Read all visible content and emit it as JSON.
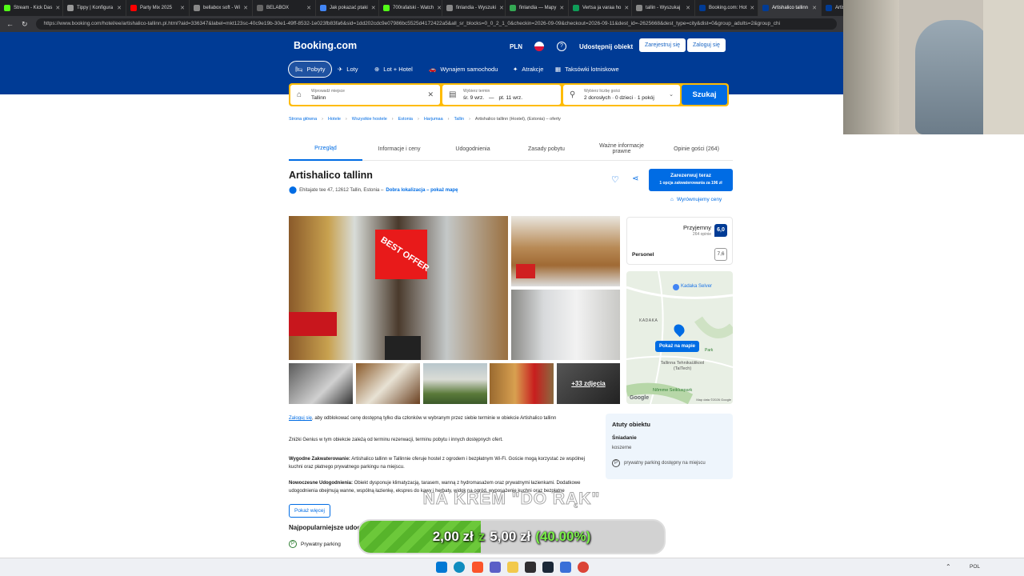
{
  "browser": {
    "tabs": [
      {
        "label": "Stream - Kick Das",
        "color": "#53fc18"
      },
      {
        "label": "Tippy | Konfigura",
        "color": "#999999"
      },
      {
        "label": "Party Mix 2025",
        "color": "#ff0000"
      },
      {
        "label": "bellabox soft - Wi",
        "color": "#888888"
      },
      {
        "label": "BELABOX",
        "color": "#666666"
      },
      {
        "label": "Jak pokazać ptaki",
        "color": "#4285f4"
      },
      {
        "label": "700rafalski - Watch",
        "color": "#53fc18"
      },
      {
        "label": "finlandia - Wyszuki",
        "color": "#888888"
      },
      {
        "label": "finlandia — Mapy",
        "color": "#34a853"
      },
      {
        "label": "Vertsa ja varaa ho",
        "color": "#0f9d58"
      },
      {
        "label": "tallin - Wyszukaj",
        "color": "#888888"
      },
      {
        "label": "Booking.com: Hot",
        "color": "#003b95"
      },
      {
        "label": "Artishalico tallinn",
        "color": "#003b95"
      },
      {
        "label": "Artishal",
        "color": "#003b95"
      }
    ],
    "url": "https://www.booking.com/hotel/ee/artishalico-tallinn.pl.html?aid=336347&label=mkt123sc-40c9e19b-30e1-49ff-8532-1e023fb83fa6&sid=1dd202cdc9e07986bc5525d4172422a5&all_sr_blocks=0_0_2_1_0&checkin=2026-09-09&checkout=2026-09-11&dest_id=-2625668&dest_type=city&dist=0&group_adults=2&group_chi"
  },
  "header": {
    "logo": "Booking.com",
    "currency": "PLN",
    "help": "?",
    "list_property": "Udostępnij obiekt",
    "register": "Zarejestruj się",
    "login": "Zaloguj się",
    "nav": [
      {
        "label": "Pobyty",
        "icon": "bed-icon"
      },
      {
        "label": "Loty",
        "icon": "plane-icon"
      },
      {
        "label": "Lot + Hotel",
        "icon": "flight-hotel-icon"
      },
      {
        "label": "Wynajem samochodu",
        "icon": "car-icon"
      },
      {
        "label": "Atrakcje",
        "icon": "attractions-icon"
      },
      {
        "label": "Taksówki lotniskowe",
        "icon": "taxi-icon"
      }
    ]
  },
  "search": {
    "destination_label": "Wprowadź miejsce",
    "destination_value": "Tallinn",
    "dates_label": "Wybierz termin",
    "date_from": "śr. 9 wrz.",
    "date_sep": "—",
    "date_to": "pt. 11 wrz.",
    "guests_label": "Wybierz liczbę gości",
    "guests_value": "2 dorosłych · 0 dzieci · 1 pokój",
    "button": "Szukaj"
  },
  "breadcrumbs": [
    "Strona główna",
    "Hotele",
    "Wszystkie hostele",
    "Estonia",
    "Harjumaa",
    "Tallin",
    "Artishalico tallinn (Hostel), (Estonia) – oferty"
  ],
  "page_tabs": [
    "Przegląd",
    "Informacje i ceny",
    "Udogodnienia",
    "Zasady pobytu",
    "Ważne informacje prawne",
    "Opinie gości (264)"
  ],
  "hotel": {
    "name": "Artishalico tallinn",
    "address": "Ehitajate tee 47, 12612 Tallin, Estonia –",
    "location_link": "Dobra lokalizacja – pokaż mapę",
    "book_now": "Zarezerwuj teraz",
    "book_sub": "1 opcja zakwaterowania za 196 zł",
    "price_match": "Wyrównujemy ceny",
    "best_offer": "BEST OFFER",
    "more_photos": "+33 zdjęcia"
  },
  "reviews": {
    "label": "Przyjemny",
    "count": "264 opinie",
    "score": "6,0",
    "staff_label": "Personel",
    "staff_score": "7,6"
  },
  "map": {
    "show_map": "Pokaż na mapie",
    "places": [
      "Kadaka Selver",
      "KADAKA",
      "Tallinna Tehnikaülikool (TalTech)",
      "Nõmme Seikluspark",
      "Park"
    ],
    "attribution": "Map data ©2026 Google",
    "google": "Google"
  },
  "description": {
    "login_link": "Zaloguj się",
    "login_text": ", aby odblokować cenę dostępną tylko dla członków w wybranym przez siebie terminie w obiekcie Artishalico tallinn",
    "genius": "Zniżki Genius w tym obiekcie zależą od terminu rezerwacji, terminu pobytu i innych dostępnych ofert.",
    "comfort_title": "Wygodne Zakwaterowanie:",
    "comfort_text": " Artishalico tallinn w Tallinnie oferuje hostel z ogrodem i bezpłatnym Wi-Fi. Goście mogą korzystać ze wspólnej kuchni oraz płatnego prywatnego parkingu na miejscu.",
    "modern_title": "Nowoczesne Udogodnienia:",
    "modern_text": " Obiekt dysponuje klimatyzacją, tarasem, wanną z hydromasażem oraz prywatnymi łazienkami. Dodatkowe udogodnienia obejmują wanne, wspólną łazienkę, ekspres do kawy i herbaty, widok na ogród, wyposażenie kuchni oraz bezpłatne kosmetyki.",
    "show_more": "Pokaż więcej",
    "popular_title": "Najpopularniejsze udogodnienia",
    "popular_items": [
      "Prywatny parking"
    ]
  },
  "highlights": {
    "title": "Atuty obiektu",
    "breakfast_title": "Śniadanie",
    "breakfast_value": "koszerne",
    "parking": "prywatny parking dostępny na miejscu"
  },
  "overlay": {
    "message": "NA KREM \"DO RĄK\"",
    "current": "2,00 zł",
    "of": "z",
    "goal": "5,00 zł",
    "percent": "(40.00%)",
    "progress": 0.4
  },
  "taskbar": {
    "lang": "POL",
    "icons": [
      "windows-icon",
      "edge-icon",
      "brave-icon",
      "teams-icon",
      "files-icon",
      "obs-icon",
      "steam-icon",
      "app-icon",
      "chrome-icon"
    ]
  }
}
